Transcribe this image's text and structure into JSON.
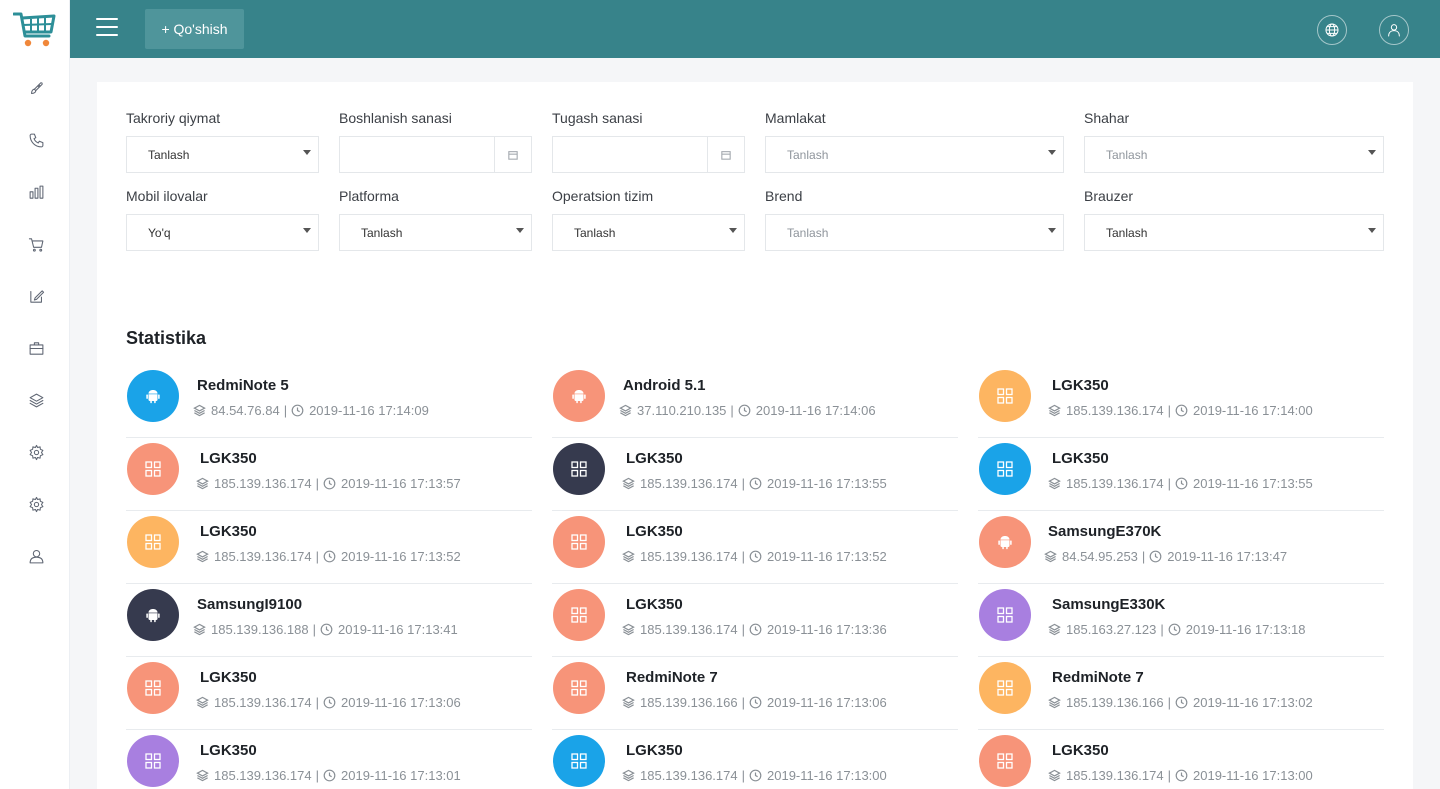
{
  "topbar": {
    "add_label": "+ Qo'shish",
    "background": "#37838a"
  },
  "sidebar": {
    "icons": [
      "rocket-icon",
      "phone-icon",
      "bar-chart-icon",
      "cart-icon",
      "edit-icon",
      "briefcase-icon",
      "layers-icon",
      "gear-icon",
      "gear-icon",
      "user-icon"
    ]
  },
  "filters": {
    "row1": {
      "repeat": {
        "label": "Takroriy qiymat",
        "value": "Tanlash"
      },
      "start_date": {
        "label": "Boshlanish sanasi",
        "value": ""
      },
      "end_date": {
        "label": "Tugash sanasi",
        "value": ""
      },
      "country": {
        "label": "Mamlakat",
        "value": "Tanlash"
      },
      "city": {
        "label": "Shahar",
        "value": "Tanlash"
      }
    },
    "row2": {
      "mobile_apps": {
        "label": "Mobil ilovalar",
        "value": "Yo'q"
      },
      "platform": {
        "label": "Platforma",
        "value": "Tanlash"
      },
      "os": {
        "label": "Operatsion tizim",
        "value": "Tanlash"
      },
      "brand": {
        "label": "Brend",
        "value": "Tanlash"
      },
      "browser": {
        "label": "Brauzer",
        "value": "Tanlash"
      }
    }
  },
  "statistics": {
    "title": "Statistika",
    "items": [
      {
        "name": "RedmiNote 5",
        "ip": "84.54.76.84",
        "time": "2019-11-16 17:14:09",
        "color": "#1aa3e8",
        "icon": "android-icon"
      },
      {
        "name": "Android 5.1",
        "ip": "37.110.210.135",
        "time": "2019-11-16 17:14:06",
        "color": "#f79479",
        "icon": "android-icon"
      },
      {
        "name": "LGK350",
        "ip": "185.139.136.174",
        "time": "2019-11-16 17:14:00",
        "color": "#fdb561",
        "icon": "grid-icon"
      },
      {
        "name": "LGK350",
        "ip": "185.139.136.174",
        "time": "2019-11-16 17:13:57",
        "color": "#f79479",
        "icon": "grid-icon"
      },
      {
        "name": "LGK350",
        "ip": "185.139.136.174",
        "time": "2019-11-16 17:13:55",
        "color": "#363a4e",
        "icon": "grid-icon"
      },
      {
        "name": "LGK350",
        "ip": "185.139.136.174",
        "time": "2019-11-16 17:13:55",
        "color": "#1aa3e8",
        "icon": "grid-icon"
      },
      {
        "name": "LGK350",
        "ip": "185.139.136.174",
        "time": "2019-11-16 17:13:52",
        "color": "#fdb561",
        "icon": "grid-icon"
      },
      {
        "name": "LGK350",
        "ip": "185.139.136.174",
        "time": "2019-11-16 17:13:52",
        "color": "#f79479",
        "icon": "grid-icon"
      },
      {
        "name": "SamsungE370K",
        "ip": "84.54.95.253",
        "time": "2019-11-16 17:13:47",
        "color": "#f79479",
        "icon": "android-icon"
      },
      {
        "name": "SamsungI9100",
        "ip": "185.139.136.188",
        "time": "2019-11-16 17:13:41",
        "color": "#363a4e",
        "icon": "android-icon"
      },
      {
        "name": "LGK350",
        "ip": "185.139.136.174",
        "time": "2019-11-16 17:13:36",
        "color": "#f79479",
        "icon": "grid-icon"
      },
      {
        "name": "SamsungE330K",
        "ip": "185.163.27.123",
        "time": "2019-11-16 17:13:18",
        "color": "#a87fe0",
        "icon": "grid-icon"
      },
      {
        "name": "LGK350",
        "ip": "185.139.136.174",
        "time": "2019-11-16 17:13:06",
        "color": "#f79479",
        "icon": "grid-icon"
      },
      {
        "name": "RedmiNote 7",
        "ip": "185.139.136.166",
        "time": "2019-11-16 17:13:06",
        "color": "#f79479",
        "icon": "grid-icon"
      },
      {
        "name": "RedmiNote 7",
        "ip": "185.139.136.166",
        "time": "2019-11-16 17:13:02",
        "color": "#fdb561",
        "icon": "grid-icon"
      },
      {
        "name": "LGK350",
        "ip": "185.139.136.174",
        "time": "2019-11-16 17:13:01",
        "color": "#a87fe0",
        "icon": "grid-icon"
      },
      {
        "name": "LGK350",
        "ip": "185.139.136.174",
        "time": "2019-11-16 17:13:00",
        "color": "#1aa3e8",
        "icon": "grid-icon"
      },
      {
        "name": "LGK350",
        "ip": "185.139.136.174",
        "time": "2019-11-16 17:13:00",
        "color": "#f79479",
        "icon": "grid-icon"
      }
    ]
  }
}
